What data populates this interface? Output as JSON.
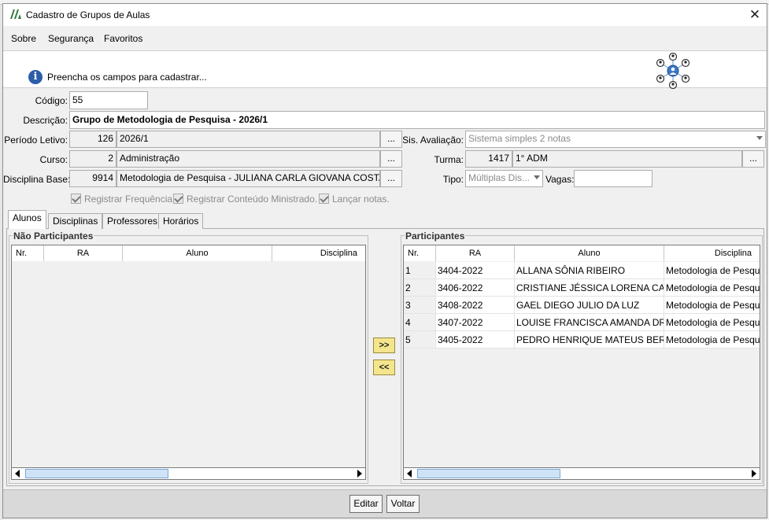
{
  "window": {
    "title": "Cadastro de Grupos de Aulas",
    "close_glyph": "✕"
  },
  "menu": {
    "items": [
      "Sobre",
      "Segurança",
      "Favoritos"
    ]
  },
  "info": {
    "message": "Preencha os campos para cadastrar...",
    "icon": "info-icon",
    "icon_glyph": "i",
    "graphic": "people-network-icon"
  },
  "form": {
    "codigo_label": "Código:",
    "codigo_value": "55",
    "descricao_label": "Descrição:",
    "descricao_value": "Grupo de Metodologia de Pesquisa - 2026/1",
    "periodo_label": "Período Letivo:",
    "periodo_code": "126",
    "periodo_name": "2026/1",
    "curso_label": "Curso:",
    "curso_code": "2",
    "curso_name": "Administração",
    "disciplina_label": "Disciplina Base:",
    "disciplina_code": "9914",
    "disciplina_name": "Metodologia de Pesquisa - JULIANA CARLA GIOVANA COSTA",
    "lookup_glyph": "...",
    "sis_avaliacao_label": "Sis. Avaliação:",
    "sis_avaliacao_value": "Sistema simples 2 notas",
    "turma_label": "Turma:",
    "turma_code": "1417",
    "turma_name": "1° ADM",
    "tipo_label": "Tipo:",
    "tipo_value": "Múltiplas Dis...",
    "vagas_label": "Vagas:",
    "vagas_value": "",
    "checkboxes": [
      {
        "label": "Registrar Frequência.",
        "checked": true
      },
      {
        "label": "Registrar Conteúdo Ministrado.",
        "checked": true
      },
      {
        "label": "Lançar notas.",
        "checked": true
      }
    ]
  },
  "tabs": [
    "Alunos",
    "Disciplinas",
    "Professores",
    "Horários"
  ],
  "nao_participantes": {
    "title": "Não Participantes",
    "columns": [
      "Nr.",
      "RA",
      "Aluno",
      "Disciplina"
    ],
    "rows": []
  },
  "participantes": {
    "title": "Participantes",
    "columns": [
      "Nr.",
      "RA",
      "Aluno",
      "Disciplina"
    ],
    "rows": [
      [
        "1",
        "3404-2022",
        "ALLANA SÔNIA RIBEIRO",
        "Metodologia de Pesqu"
      ],
      [
        "2",
        "3406-2022",
        "CRISTIANE JÉSSICA LORENA CAM...",
        "Metodologia de Pesqu"
      ],
      [
        "3",
        "3408-2022",
        "GAEL DIEGO JULIO DA LUZ",
        "Metodologia de Pesqu"
      ],
      [
        "4",
        "3407-2022",
        "LOUISE FRANCISCA AMANDA DR...",
        "Metodologia de Pesqu"
      ],
      [
        "5",
        "3405-2022",
        "PEDRO HENRIQUE MATEUS BERN...",
        "Metodologia de Pesqu"
      ]
    ]
  },
  "transfer": {
    "add_label": ">>",
    "remove_label": "<<"
  },
  "footer": {
    "edit_label": "Editar",
    "back_label": "Voltar"
  },
  "colors": {
    "move_button": "#f3e58c",
    "info_icon": "#2c5da8"
  }
}
